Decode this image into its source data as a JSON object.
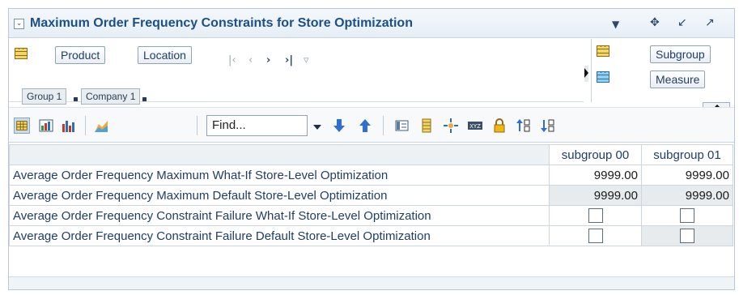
{
  "window": {
    "title": "Maximum Order Frequency Constraints for Store Optimization",
    "collapse_icon": "chevron-down-icon",
    "menu_icon": "caret-down-icon",
    "move_icon": "move-icon",
    "minimize_icon": "restore-icon",
    "maximize_icon": "maximize-icon"
  },
  "pivot": {
    "row_dimensions": [
      "Product",
      "Location"
    ],
    "column_dimensions": [
      "Subgroup",
      "Measure"
    ],
    "breadcrumbs": [
      "Group 1",
      "Company 1"
    ]
  },
  "toolbar": {
    "find_placeholder": "Find..."
  },
  "grid": {
    "columns": [
      "subgroup 00",
      "subgroup 01"
    ],
    "rows": [
      {
        "label": "Average Order Frequency Maximum What-If Store-Level Optimization",
        "values": [
          "9999.00",
          "9999.00"
        ]
      },
      {
        "label": "Average Order Frequency Maximum Default Store-Level Optimization",
        "values": [
          "9999.00",
          "9999.00"
        ]
      },
      {
        "label": "Average Order Frequency Constraint Failure What-If Store-Level Optimization",
        "values": [
          false,
          false
        ]
      },
      {
        "label": "Average Order Frequency Constraint Failure Default Store-Level Optimization",
        "values": [
          false,
          false
        ]
      }
    ]
  },
  "colors": {
    "title": "#1c4f86",
    "link": "#1f3e66",
    "readonly_cell": "#e8ebee",
    "border": "#cdd6df"
  }
}
